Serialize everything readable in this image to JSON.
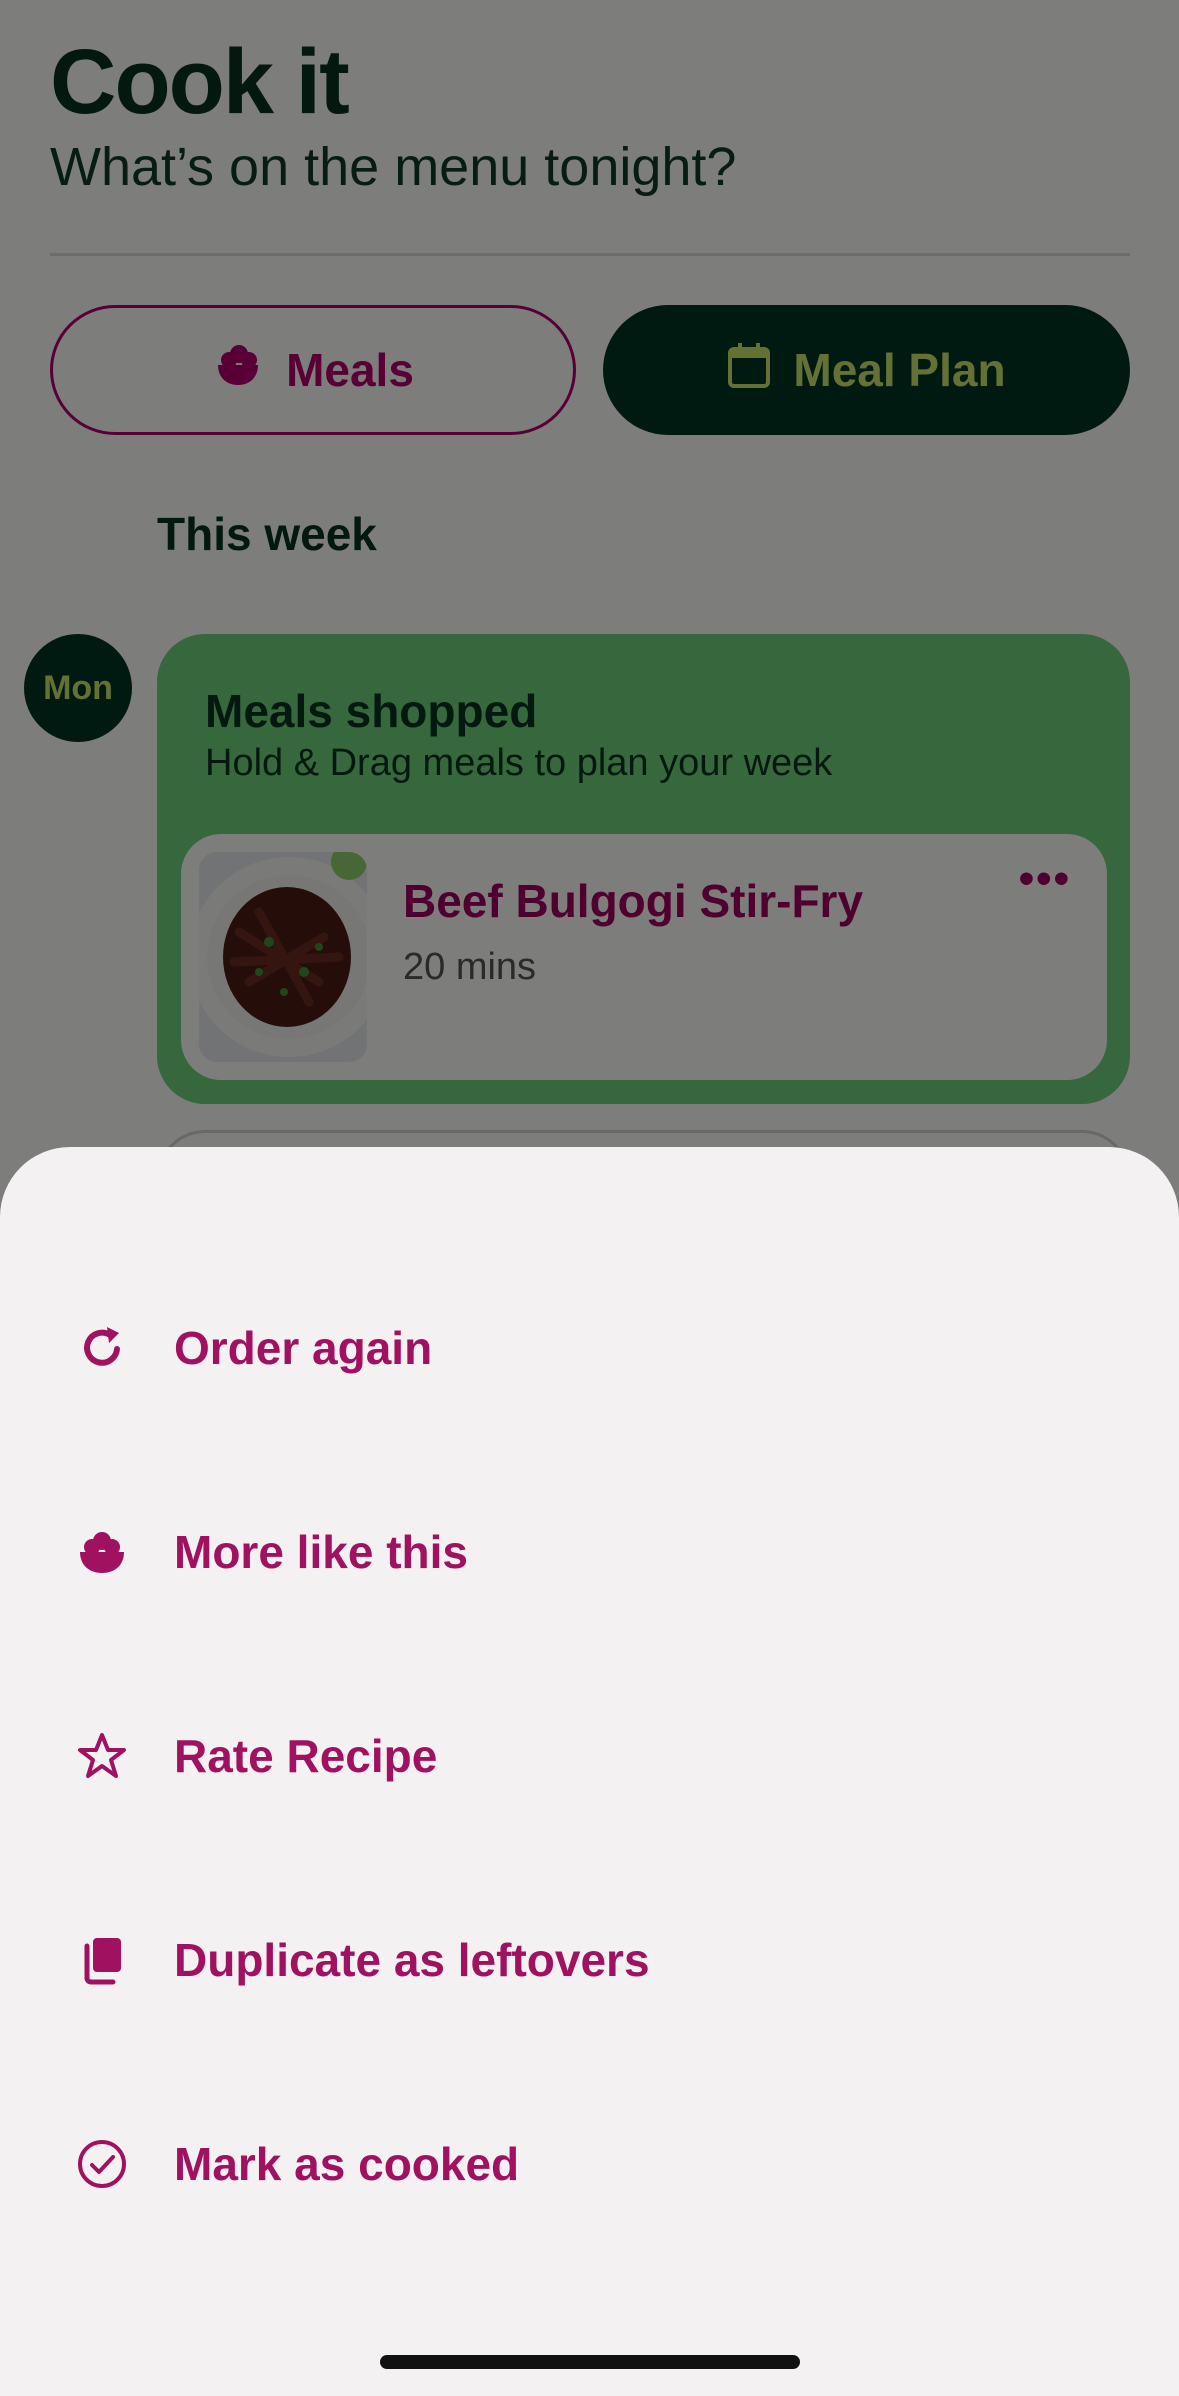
{
  "header": {
    "title": "Cook it",
    "subtitle": "What’s on the menu tonight?"
  },
  "tabs": {
    "meals_label": "Meals",
    "meal_plan_label": "Meal Plan"
  },
  "week": {
    "label": "This week",
    "day": "Mon",
    "shopped_title": "Meals shopped",
    "shopped_subtitle": "Hold & Drag meals to plan your week"
  },
  "meal": {
    "name": "Beef Bulgogi Stir-Fry",
    "time": "20 mins",
    "more_icon": "more-dots-icon"
  },
  "sheet": {
    "actions": [
      {
        "label": "Order again",
        "icon": "refresh-icon"
      },
      {
        "label": "More like this",
        "icon": "bowl-icon"
      },
      {
        "label": "Rate Recipe",
        "icon": "star-icon"
      },
      {
        "label": "Duplicate as leftovers",
        "icon": "copy-icon"
      },
      {
        "label": "Mark as cooked",
        "icon": "check-circle-icon"
      }
    ]
  },
  "colors": {
    "brand_green": "#023422",
    "accent_lime": "#c9e36a",
    "accent_magenta": "#a0125f",
    "card_green": "#6fcf7a",
    "sheet_bg": "#f4f1f3"
  }
}
